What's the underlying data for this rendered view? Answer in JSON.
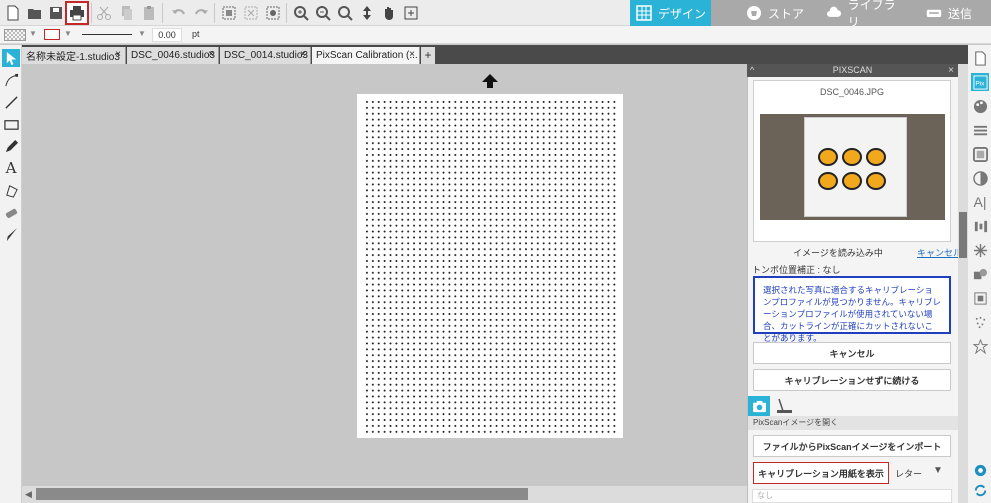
{
  "mode_tabs": [
    "デザイン",
    "ストア",
    "ライブラリ",
    "送信"
  ],
  "line_width": {
    "value": "0.00",
    "unit": "pt"
  },
  "doc_tabs": [
    "名称未設定-1.studio3",
    "DSC_0046.studio3",
    "DSC_0014.studio3",
    "PixScan Calibration (..."
  ],
  "tab_close": "×",
  "add_tab": "+",
  "panel": {
    "title": "PIXSCAN",
    "close": "×",
    "collapse": "^",
    "image_name": "DSC_0046.JPG",
    "loading_text": "イメージを読み込み中",
    "cancel_link": "キャンセル",
    "registration": "トンボ位置補正 : なし",
    "warning": "選択された写真に適合するキャリブレーションプロファイルが見つかりません。キャリブレーションプロファイルが使用されていない場合、カットラインが正確にカットされないことがあります。",
    "cancel_button": "キャンセル",
    "continue_button": "キャリブレーションせずに続ける",
    "open_label": "PixScanイメージを開く",
    "import_button": "ファイルからPixScanイメージをインポート",
    "show_calibration_button": "キャリブレーション用紙を表示",
    "paper_size": "レター",
    "bottom_label": "なし"
  },
  "accent_color": "#2ab3d6",
  "warning_color": "#1f3fbf"
}
